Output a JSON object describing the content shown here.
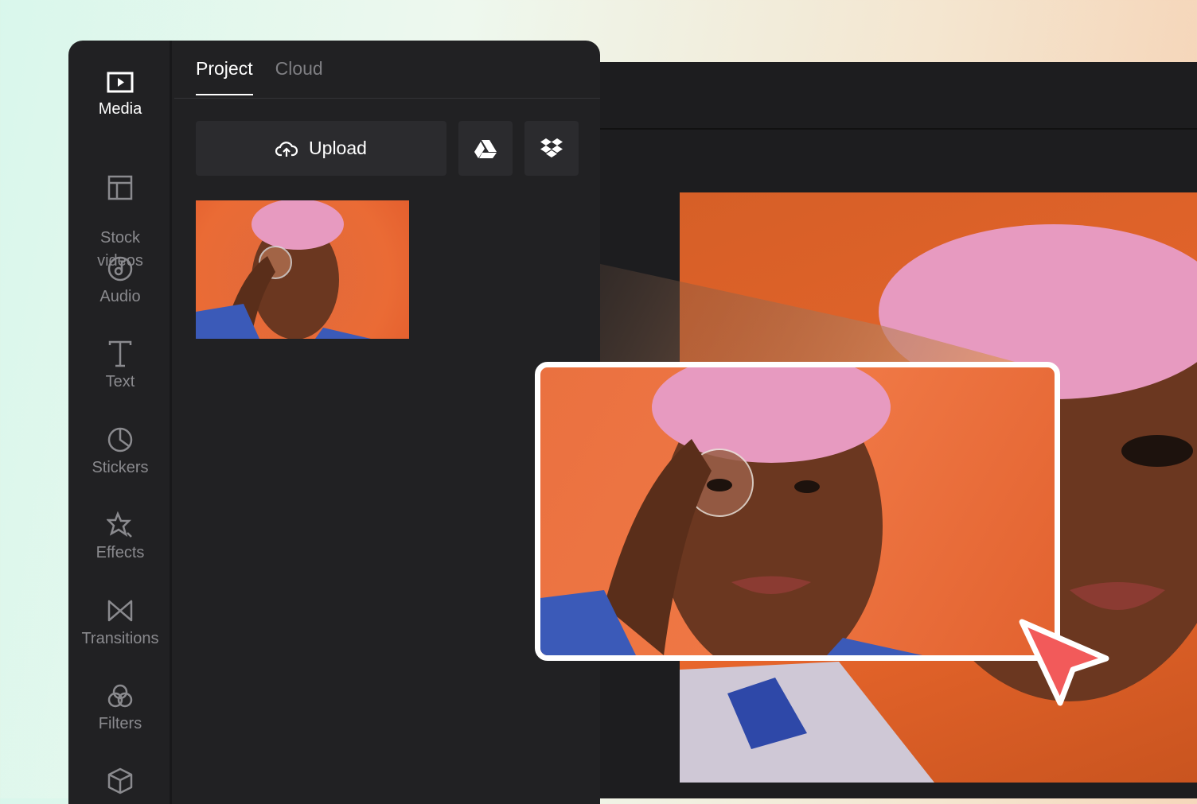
{
  "sidebar": {
    "items": [
      {
        "label": "Media",
        "icon": "media-play-icon",
        "active": true
      },
      {
        "label": "Stock\nvideos",
        "icon": "stock-layout-icon"
      },
      {
        "label": "Audio",
        "icon": "audio-note-icon"
      },
      {
        "label": "Text",
        "icon": "text-t-icon"
      },
      {
        "label": "Stickers",
        "icon": "sticker-icon"
      },
      {
        "label": "Effects",
        "icon": "effects-star-icon"
      },
      {
        "label": "Transitions",
        "icon": "transitions-bowtie-icon"
      },
      {
        "label": "Filters",
        "icon": "filters-circles-icon"
      },
      {
        "label": "",
        "icon": "cube-icon"
      }
    ]
  },
  "tabs": [
    {
      "label": "Project",
      "active": true
    },
    {
      "label": "Cloud"
    }
  ],
  "upload": {
    "label": "Upload",
    "icon": "cloud-upload-icon"
  },
  "integrations": [
    {
      "icon": "google-drive-icon"
    },
    {
      "icon": "dropbox-icon"
    }
  ],
  "colors": {
    "accent_cursor": "#f25a5a",
    "photo_bg": "#e8662c",
    "hair": "#e79ac0"
  }
}
